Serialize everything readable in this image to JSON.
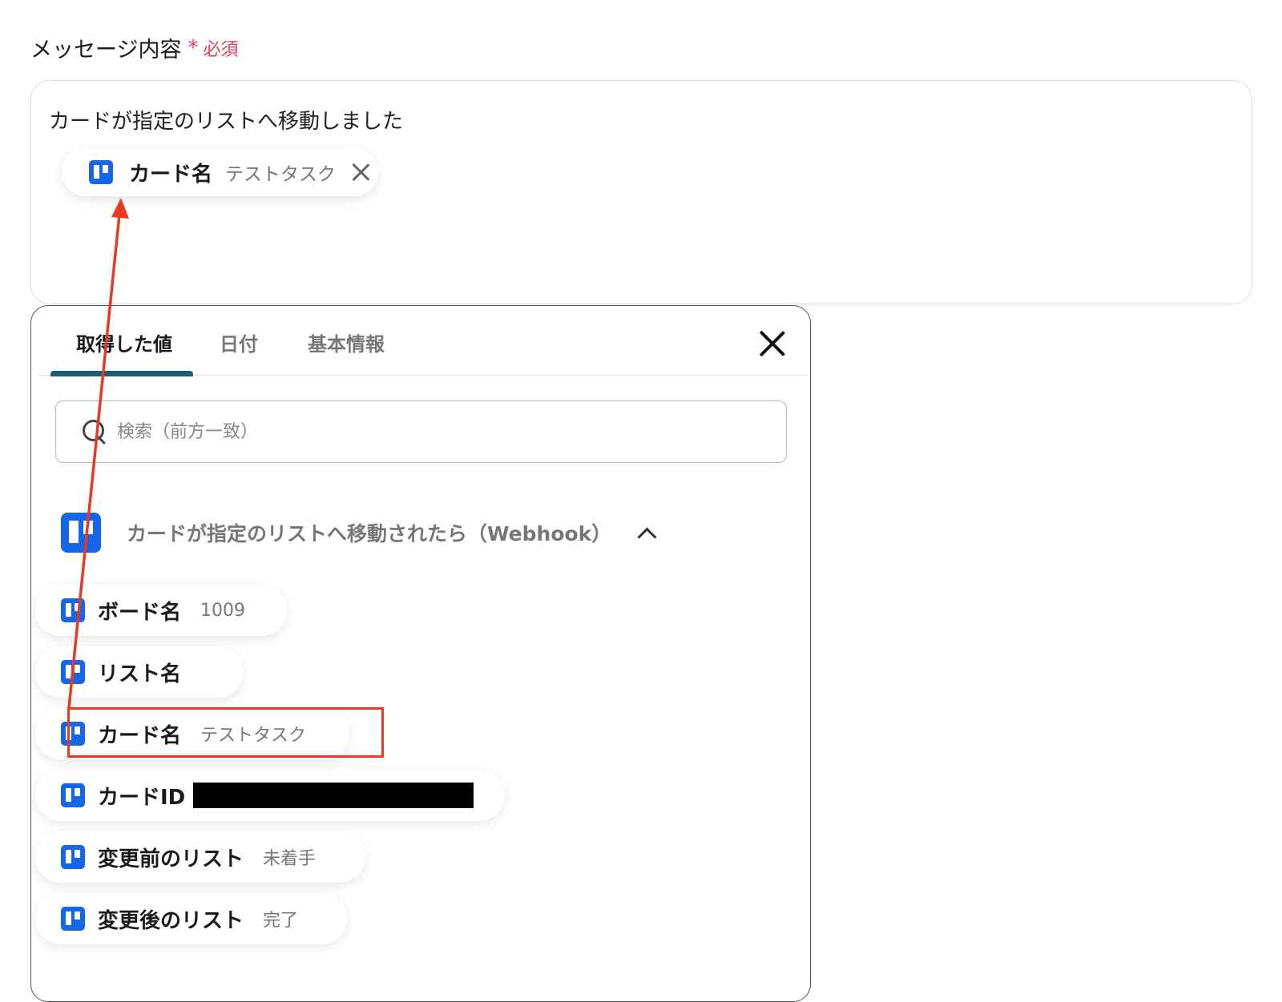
{
  "field": {
    "label": "メッセージ内容",
    "required_mark": "*",
    "required_text": "必須"
  },
  "editor": {
    "text": "カードが指定のリストへ移動しました",
    "chip": {
      "name": "カード名",
      "value": "テストタスク",
      "icon": "trello-icon"
    }
  },
  "panel": {
    "tabs": [
      {
        "label": "取得した値",
        "active": true
      },
      {
        "label": "日付",
        "active": false
      },
      {
        "label": "基本情報",
        "active": false
      }
    ],
    "search": {
      "placeholder": "検索（前方一致）",
      "value": ""
    },
    "group": {
      "title": "カードが指定のリストへ移動されたら（Webhook）",
      "icon": "trello-icon",
      "expanded": true,
      "items": [
        {
          "name": "ボード名",
          "value": "1009"
        },
        {
          "name": "リスト名",
          "value": ""
        },
        {
          "name": "カード名",
          "value": "テストタスク",
          "highlighted": true
        },
        {
          "name": "カードID",
          "value": "",
          "redacted": true
        },
        {
          "name": "変更前のリスト",
          "value": "未着手"
        },
        {
          "name": "変更後のリスト",
          "value": "完了"
        }
      ]
    }
  },
  "colors": {
    "accent": "#1c5d75",
    "trello": "#1566e8",
    "required": "#ef3b5c",
    "annotation": "#e83a22"
  }
}
